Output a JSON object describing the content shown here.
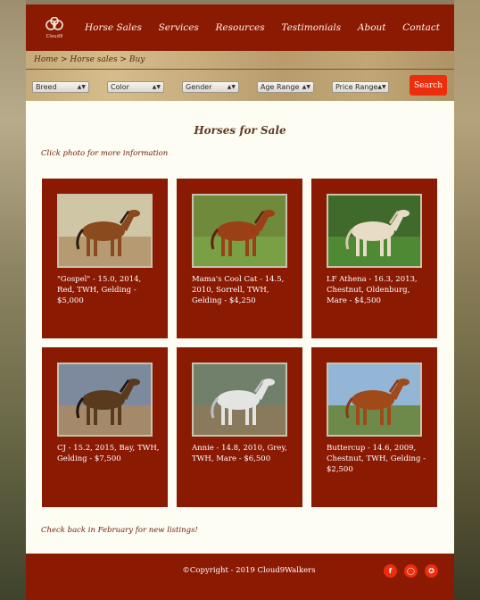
{
  "nav": {
    "logo_text": "Cloud9",
    "items": [
      "Horse Sales",
      "Services",
      "Resources",
      "Testimonials",
      "About",
      "Contact"
    ]
  },
  "breadcrumb": "Home > Horse sales > Buy",
  "filters": [
    "Breed",
    "Color",
    "Gender",
    "Age Range",
    "Price Range"
  ],
  "search_label": "Search",
  "main": {
    "title": "Horses for Sale",
    "hint": "Click photo for more information",
    "footnote": "Check back in February for new listings!"
  },
  "horses": [
    {
      "caption": "\"Gospel\" - 15.0, 2014, Red, TWH, Gelding - $5,000",
      "coat": "#8a4a1e",
      "mane": "#2a1a10",
      "sky": "#cfc6a6",
      "ground": "#b59a72"
    },
    {
      "caption": "Mama's Cool Cat - 14.5, 2010, Sorrell, TWH, Gelding - $4,250",
      "coat": "#9a3f16",
      "mane": "#5a2410",
      "sky": "#6e8a3a",
      "ground": "#7aa046"
    },
    {
      "caption": "LF Athena - 16.3, 2013, Chestnut, Oldenburg, Mare - $4,500",
      "coat": "#e9dcc6",
      "mane": "#d8c9ae",
      "sky": "#3f6a2c",
      "ground": "#4e8a34"
    },
    {
      "caption": "CJ - 15.2, 2015, Bay, TWH, Gelding - $7,500",
      "coat": "#5a3a1c",
      "mane": "#1e140c",
      "sky": "#7d8a9e",
      "ground": "#a48a6a"
    },
    {
      "caption": "Annie - 14.8, 2010, Grey, TWH, Mare - $6,500",
      "coat": "#e4e4e2",
      "mane": "#bfbfbf",
      "sky": "#70806a",
      "ground": "#8a7a5c"
    },
    {
      "caption": "Buttercup - 14.6, 2009, Chestnut, TWH, Gelding - $2,500",
      "coat": "#a04a1a",
      "mane": "#8a3a12",
      "sky": "#94b6d6",
      "ground": "#6e8a4a"
    }
  ],
  "footer": {
    "copyright": "©Copyright - 2019 Cloud9Walkers",
    "social": [
      "facebook-icon",
      "instagram-icon",
      "twitter-icon"
    ]
  }
}
